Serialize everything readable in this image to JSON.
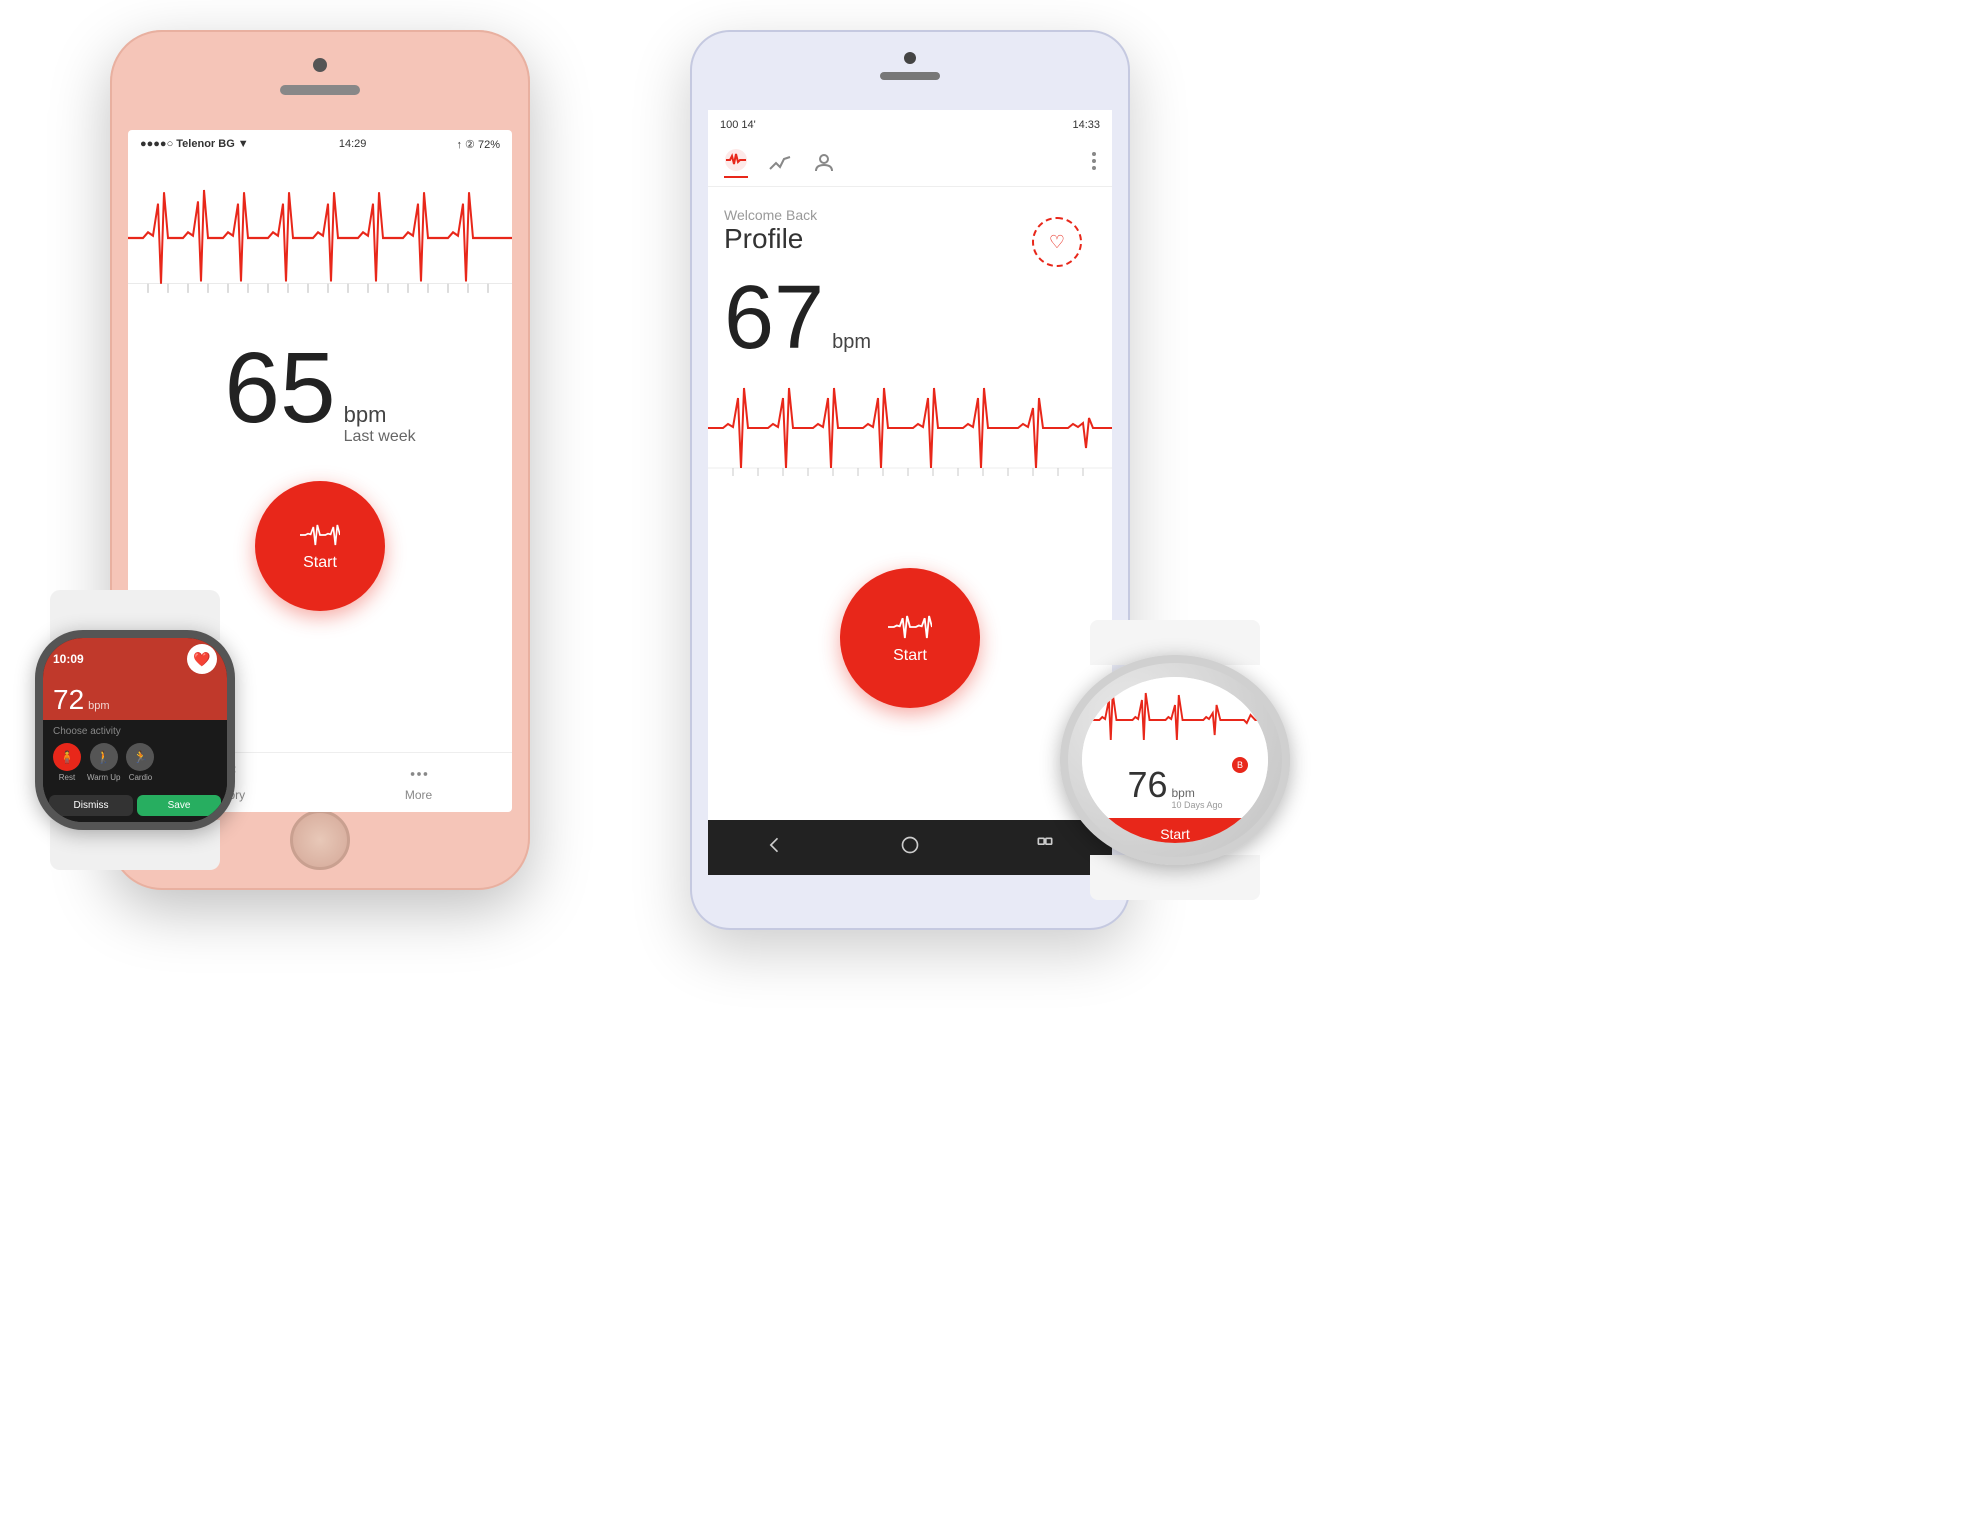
{
  "iphone": {
    "statusbar": {
      "carrier": "●●●●○ Telenor BG ▼",
      "time": "14:29",
      "right": "↑ ② 72%"
    },
    "bpm": "65",
    "bpm_unit": "bpm",
    "bpm_sublabel": "Last week",
    "start_label": "Start",
    "tabs": [
      {
        "label": "History",
        "icon": "list-icon"
      },
      {
        "label": "More",
        "icon": "more-icon"
      }
    ]
  },
  "apple_watch": {
    "time": "10:09",
    "bpm": "72",
    "bpm_unit": "bpm",
    "activity_label": "Choose activity",
    "activities": [
      {
        "label": "Rest",
        "icon": "rest-icon",
        "active": true
      },
      {
        "label": "Warm Up",
        "icon": "walk-icon",
        "active": false
      },
      {
        "label": "Cardio",
        "icon": "run-icon",
        "active": false
      }
    ],
    "dismiss_label": "Dismiss",
    "save_label": "Save"
  },
  "android": {
    "statusbar": {
      "left": "100  14'",
      "right": "14:33"
    },
    "welcome_back": "Welcome Back",
    "profile_title": "Profile",
    "bpm": "67",
    "bpm_unit": "bpm",
    "start_label": "Start",
    "nav_icons": [
      "back-icon",
      "home-icon",
      "overview-icon"
    ]
  },
  "gear_watch": {
    "bpm": "76",
    "bpm_unit": "bpm",
    "bpm_sublabel": "10 Days Ago",
    "start_label": "Start"
  },
  "colors": {
    "primary_red": "#e8271a",
    "iphone_body": "#f5c5b8",
    "android_body": "#e8eaf6",
    "text_dark": "#222222",
    "text_medium": "#666666",
    "text_light": "#999999"
  }
}
